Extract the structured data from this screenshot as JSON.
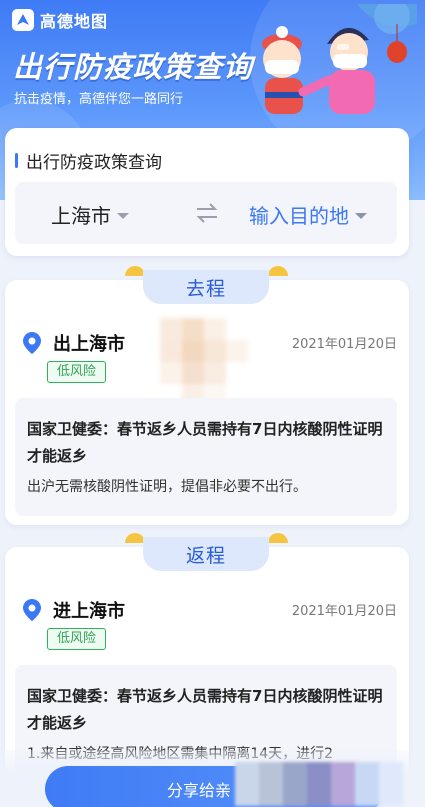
{
  "header": {
    "logo_text": "高德地图",
    "title": "出行防疫政策查询",
    "subtitle": "抗击疫情，高德伴您一路同行"
  },
  "query": {
    "title": "出行防疫政策查询",
    "from_city": "上海市",
    "to_city": "输入目的地"
  },
  "outbound": {
    "tab_label": "去程",
    "city": "出上海市",
    "date": "2021年01月20日",
    "risk": "低风险",
    "policy_title": "国家卫健委：春节返乡人员需持有7日内核酸阴性证明才能返乡",
    "policy_detail": "出沪无需核酸阴性证明，提倡非必要不出行。"
  },
  "return": {
    "tab_label": "返程",
    "city": "进上海市",
    "date": "2021年01月20日",
    "risk": "低风险",
    "policy_title": "国家卫健委：春节返乡人员需持有7日内核酸阴性证明才能返乡",
    "policy_detail": "1.来自或途经高风险地区需集中隔离14天，进行2"
  },
  "share": {
    "label": "分享给亲"
  },
  "colors": {
    "accent": "#3b78f6",
    "risk_green": "#2fb35a",
    "tab_ear": "#f5c542"
  }
}
